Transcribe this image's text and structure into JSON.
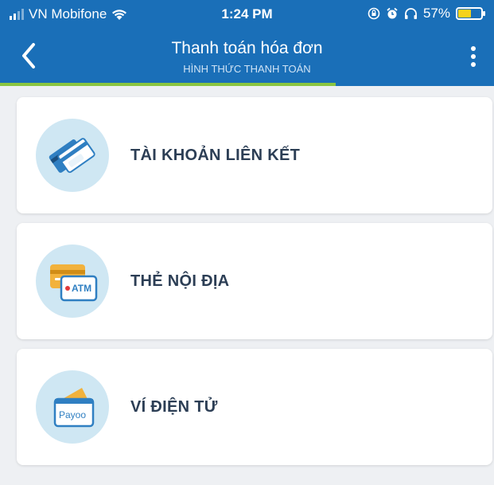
{
  "status_bar": {
    "carrier": "VN Mobifone",
    "time": "1:24 PM",
    "battery": "57%",
    "battery_level": 0.57
  },
  "nav": {
    "title": "Thanh toán hóa đơn",
    "subtitle": "HÌNH THỨC THANH TOÁN",
    "progress": 0.68
  },
  "options": [
    {
      "label": "TÀI KHOẢN LIÊN KẾT",
      "icon": "linked-cards-icon"
    },
    {
      "label": "THẺ NỘI ĐỊA",
      "icon": "atm-card-icon",
      "icon_text": "ATM"
    },
    {
      "label": "VÍ ĐIỆN TỬ",
      "icon": "e-wallet-icon",
      "icon_text": "Payoo"
    }
  ],
  "colors": {
    "header": "#1a6fb8",
    "progress": "#8ac540",
    "icon_bg": "#cfe7f3",
    "label": "#2c3e55"
  }
}
